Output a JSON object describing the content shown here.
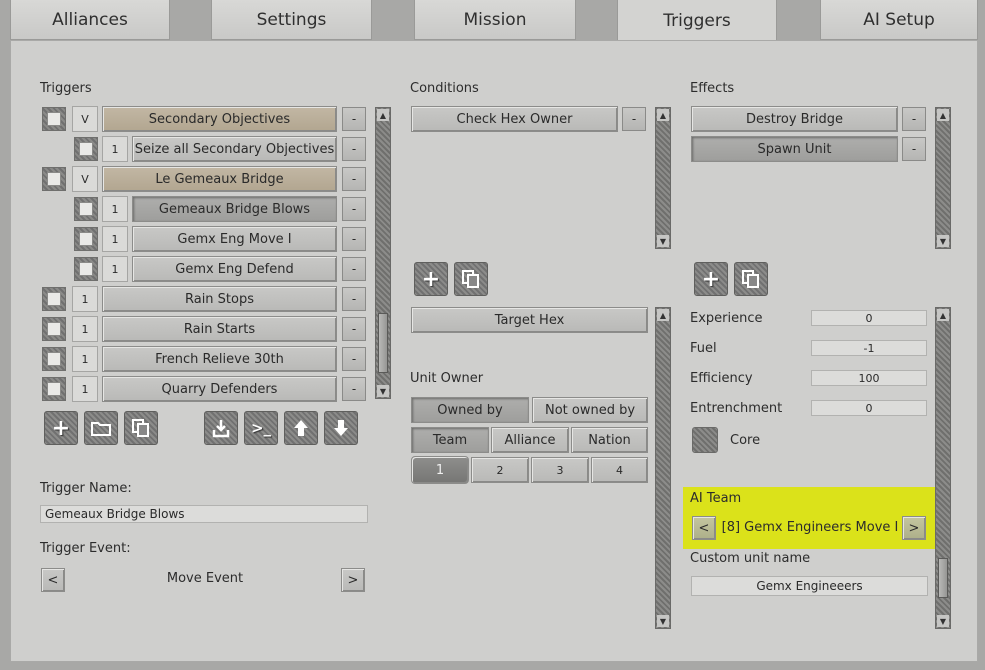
{
  "tabs": [
    "Alliances",
    "Settings",
    "Mission",
    "Triggers",
    "AI Setup"
  ],
  "triggers": {
    "title": "Triggers",
    "rows": [
      {
        "toggle": "V",
        "label": "Secondary Objectives",
        "group": true
      },
      {
        "toggle": "1",
        "label": "Seize all Secondary Objectives",
        "group": false
      },
      {
        "toggle": "V",
        "label": "Le Gemeaux Bridge",
        "group": true
      },
      {
        "toggle": "1",
        "label": "Gemeaux Bridge Blows",
        "group": false
      },
      {
        "toggle": "1",
        "label": "Gemx Eng Move I",
        "group": false
      },
      {
        "toggle": "1",
        "label": "Gemx Eng Defend",
        "group": false
      },
      {
        "toggle": "1",
        "label": "Rain Stops",
        "group": false
      },
      {
        "toggle": "1",
        "label": "Rain Starts",
        "group": false
      },
      {
        "toggle": "1",
        "label": "French Relieve 30th",
        "group": false
      },
      {
        "toggle": "1",
        "label": "Quarry Defenders",
        "group": false
      }
    ],
    "minus": "-",
    "name_label": "Trigger Name:",
    "name_value": "Gemeaux Bridge Blows",
    "event_label": "Trigger Event:",
    "event_value": "Move Event",
    "prev": "<",
    "next": ">"
  },
  "conditions": {
    "title": "Conditions",
    "items": [
      "Check Hex Owner"
    ],
    "target_hex": "Target Hex",
    "unit_owner_label": "Unit Owner",
    "owned_by": "Owned by",
    "not_owned_by": "Not owned by",
    "team": "Team",
    "alliance": "Alliance",
    "nation": "Nation",
    "numbers": [
      "1",
      "2",
      "3",
      "4"
    ]
  },
  "effects": {
    "title": "Effects",
    "items": [
      "Destroy Bridge",
      "Spawn Unit"
    ],
    "experience_label": "Experience",
    "experience_value": "0",
    "fuel_label": "Fuel",
    "fuel_value": "-1",
    "efficiency_label": "Efficiency",
    "efficiency_value": "100",
    "entrenchment_label": "Entrenchment",
    "entrenchment_value": "0",
    "core_label": "Core",
    "ai_team_label": "AI Team",
    "ai_team_value": "[8] Gemx Engineers Move I",
    "custom_name_label": "Custom unit name",
    "custom_name_value": "Gemx Engineeers"
  },
  "colors": {
    "highlight": "#dbe21a",
    "group_row": "#b9ad97"
  }
}
